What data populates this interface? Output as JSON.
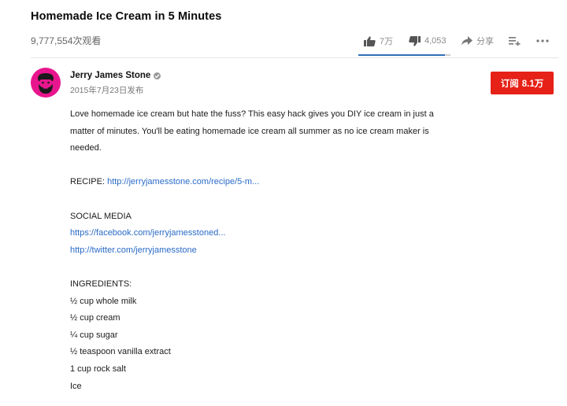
{
  "video": {
    "title": "Homemade Ice Cream in 5 Minutes",
    "views": "9,777,554次观看"
  },
  "actions": {
    "likes": "7万",
    "dislikes": "4,053",
    "share_label": "分享",
    "like_ratio": 0.94
  },
  "channel": {
    "name": "Jerry James Stone",
    "publish_date": "2015年7月23日发布",
    "avatar_color": "#e8168e"
  },
  "subscribe": {
    "label": "订阅",
    "count": "8.1万",
    "color": "#e62117"
  },
  "description": {
    "intro": [
      "Love homemade ice cream but hate the fuss? This easy hack gives you DIY ice cream in just a",
      "matter of minutes. You'll be eating homemade ice cream all summer as no ice cream maker is",
      "needed."
    ],
    "recipe_label": "RECIPE: ",
    "recipe_link": "http://jerryjamesstone.com/recipe/5-m...",
    "social_heading": "SOCIAL MEDIA",
    "social_links": [
      "https://facebook.com/jerryjamesstoned...",
      "http://twitter.com/jerryjamesstone"
    ],
    "ingredients_heading": "INGREDIENTS:",
    "ingredients": [
      "½ cup whole milk",
      "½ cup cream",
      "¼ cup sugar",
      "½ teaspoon vanilla extract",
      "1 cup rock salt",
      "Ice"
    ]
  },
  "colors": {
    "link": "#2a6bc7",
    "sentiment_fill": "#2f6fb6"
  }
}
